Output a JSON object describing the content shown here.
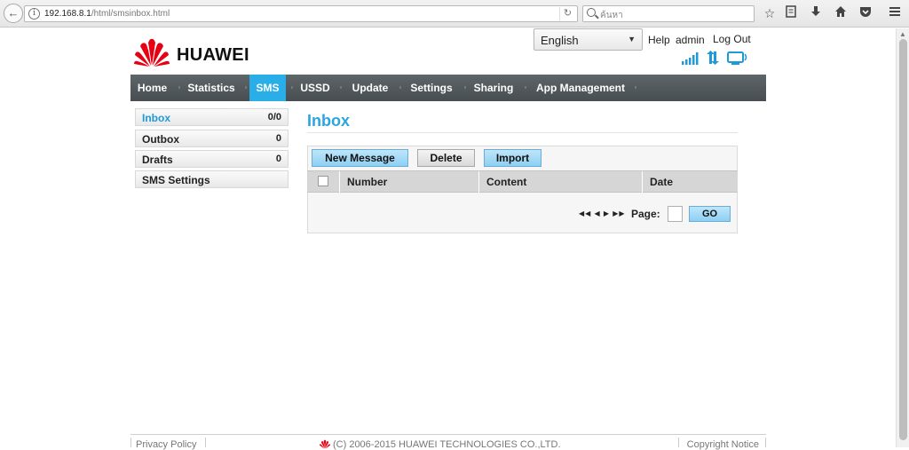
{
  "browser": {
    "url_host": "192.168.8.1",
    "url_path": "/html/smsinbox.html",
    "search_placeholder": "ค้นหา"
  },
  "header": {
    "brand": "HUAWEI",
    "language": "English",
    "help": "Help",
    "user": "admin",
    "logout": "Log Out"
  },
  "nav": {
    "items": [
      "Home",
      "Statistics",
      "SMS",
      "USSD",
      "Update",
      "Settings",
      "Sharing",
      "App Management"
    ],
    "active": "SMS"
  },
  "sidebar": {
    "items": [
      {
        "label": "Inbox",
        "count": "0/0"
      },
      {
        "label": "Outbox",
        "count": "0"
      },
      {
        "label": "Drafts",
        "count": "0"
      },
      {
        "label": "SMS Settings",
        "count": ""
      }
    ]
  },
  "main": {
    "title": "Inbox",
    "buttons": {
      "new_message": "New Message",
      "delete": "Delete",
      "import": "Import"
    },
    "columns": [
      "Number",
      "Content",
      "Date"
    ],
    "pager": {
      "arrows": "◀◀ ◀ ▶ ▶▶",
      "page_label": "Page:",
      "go": "GO"
    }
  },
  "footer": {
    "privacy": "Privacy Policy",
    "copyright": "(C) 2006-2015 HUAWEI TECHNOLOGIES CO.,LTD.",
    "notice": "Copyright Notice"
  },
  "colors": {
    "accent": "#2aaee8",
    "nav_bg": "#4f5558",
    "brand_red": "#e60012"
  }
}
